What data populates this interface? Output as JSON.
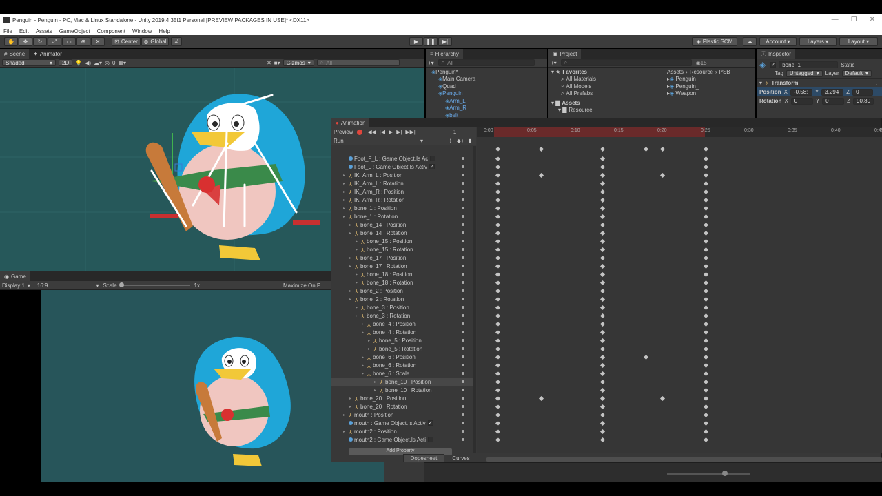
{
  "window": {
    "title": "Penguin - Penguin - PC, Mac & Linux Standalone - Unity 2019.4.35f1 Personal [PREVIEW PACKAGES IN USE]* <DX11>",
    "controls": [
      "—",
      "❐",
      "✕"
    ]
  },
  "menu": [
    "File",
    "Edit",
    "Assets",
    "GameObject",
    "Component",
    "Window",
    "Help"
  ],
  "toolbar": {
    "pivot_label": "Center",
    "space_label": "Global",
    "plastic_label": "Plastic SCM",
    "account_label": "Account",
    "layers_label": "Layers",
    "layout_label": "Layout"
  },
  "scene": {
    "tab_scene": "Scene",
    "tab_animator": "Animator",
    "shading": "Shaded",
    "mode_2d": "2D",
    "hidden_count": "0",
    "gizmos": "Gizmos",
    "search_placeholder": "All"
  },
  "game": {
    "tab": "Game",
    "display": "Display 1",
    "aspect": "16:9",
    "scale_label": "Scale",
    "scale_value": "1x",
    "maximize": "Maximize On P"
  },
  "hierarchy": {
    "tab": "Hierarchy",
    "search_placeholder": "All",
    "items": [
      {
        "label": "Penguin*",
        "indent": 0
      },
      {
        "label": "Main Camera",
        "indent": 1
      },
      {
        "label": "Quad",
        "indent": 1
      },
      {
        "label": "Penguin_",
        "indent": 1
      },
      {
        "label": "Arm_L",
        "indent": 2
      },
      {
        "label": "Arm_R",
        "indent": 2
      },
      {
        "label": "belt",
        "indent": 2
      }
    ]
  },
  "project": {
    "tab": "Project",
    "favorites_label": "Favorites",
    "favorites": [
      "All Materials",
      "All Models",
      "All Prefabs"
    ],
    "assets_label": "Assets",
    "assets_children": [
      "Resource"
    ],
    "breadcrumb": [
      "Assets",
      "Resource",
      "PSB"
    ],
    "files": [
      "Penguin",
      "Penguin_",
      "Weapon"
    ],
    "layer_count": "15"
  },
  "inspector": {
    "tab": "Inspector",
    "object_name": "bone_1",
    "static_label": "Static",
    "tag_label": "Tag",
    "tag_value": "Untagged",
    "layer_label": "Layer",
    "layer_value": "Default",
    "component": "Transform",
    "position_label": "Position",
    "position": {
      "x": "-0.58:",
      "y": "3.294",
      "z": "0"
    },
    "rotation_label": "Rotation",
    "rotation": {
      "x": "0",
      "y": "0",
      "z": "90.80"
    }
  },
  "animation": {
    "tab": "Animation",
    "preview_label": "Preview",
    "frame": "1",
    "clip": "Run",
    "dopesheet_tab": "Dopesheet",
    "curves_tab": "Curves",
    "add_property": "Add Property",
    "timeline_ticks": [
      "0:00",
      "0:05",
      "0:10",
      "0:15",
      "0:20",
      "0:25",
      "0:30",
      "0:35",
      "0:40",
      "0:45"
    ],
    "properties": [
      {
        "label": "Foot_F_L : Game Object.Is Ac",
        "indent": 1,
        "icon": "g",
        "expandable": false,
        "check": ""
      },
      {
        "label": "Foot_L : Game Object.Is Activ",
        "indent": 1,
        "icon": "g",
        "expandable": false,
        "check": "✓"
      },
      {
        "label": "IK_Arm_L : Position",
        "indent": 1,
        "icon": "t",
        "expandable": true,
        "check": null
      },
      {
        "label": "IK_Arm_L : Rotation",
        "indent": 1,
        "icon": "t",
        "expandable": true,
        "check": null
      },
      {
        "label": "IK_Arm_R : Position",
        "indent": 1,
        "icon": "t",
        "expandable": true,
        "check": null
      },
      {
        "label": "IK_Arm_R : Rotation",
        "indent": 1,
        "icon": "t",
        "expandable": true,
        "check": null
      },
      {
        "label": "bone_1 : Position",
        "indent": 1,
        "icon": "t",
        "expandable": true,
        "check": null
      },
      {
        "label": "bone_1 : Rotation",
        "indent": 1,
        "icon": "t",
        "expandable": true,
        "check": null
      },
      {
        "label": "bone_14 : Position",
        "indent": 2,
        "icon": "t",
        "expandable": true,
        "check": null
      },
      {
        "label": "bone_14 : Rotation",
        "indent": 2,
        "icon": "t",
        "expandable": true,
        "check": null
      },
      {
        "label": "bone_15 : Position",
        "indent": 3,
        "icon": "t",
        "expandable": true,
        "check": null
      },
      {
        "label": "bone_15 : Rotation",
        "indent": 3,
        "icon": "t",
        "expandable": true,
        "check": null
      },
      {
        "label": "bone_17 : Position",
        "indent": 2,
        "icon": "t",
        "expandable": true,
        "check": null
      },
      {
        "label": "bone_17 : Rotation",
        "indent": 2,
        "icon": "t",
        "expandable": true,
        "check": null
      },
      {
        "label": "bone_18 : Position",
        "indent": 3,
        "icon": "t",
        "expandable": true,
        "check": null
      },
      {
        "label": "bone_18 : Rotation",
        "indent": 3,
        "icon": "t",
        "expandable": true,
        "check": null
      },
      {
        "label": "bone_2 : Position",
        "indent": 2,
        "icon": "t",
        "expandable": true,
        "check": null
      },
      {
        "label": "bone_2 : Rotation",
        "indent": 2,
        "icon": "t",
        "expandable": true,
        "check": null
      },
      {
        "label": "bone_3 : Position",
        "indent": 3,
        "icon": "t",
        "expandable": true,
        "check": null
      },
      {
        "label": "bone_3 : Rotation",
        "indent": 3,
        "icon": "t",
        "expandable": true,
        "check": null
      },
      {
        "label": "bone_4 : Position",
        "indent": 4,
        "icon": "t",
        "expandable": true,
        "check": null
      },
      {
        "label": "bone_4 : Rotation",
        "indent": 4,
        "icon": "t",
        "expandable": true,
        "check": null
      },
      {
        "label": "bone_5 : Position",
        "indent": 5,
        "icon": "t",
        "expandable": true,
        "check": null
      },
      {
        "label": "bone_5 : Rotation",
        "indent": 5,
        "icon": "t",
        "expandable": true,
        "check": null
      },
      {
        "label": "bone_6 : Position",
        "indent": 4,
        "icon": "t",
        "expandable": true,
        "check": null
      },
      {
        "label": "bone_6 : Rotation",
        "indent": 4,
        "icon": "t",
        "expandable": true,
        "check": null
      },
      {
        "label": "bone_6 : Scale",
        "indent": 4,
        "icon": "t",
        "expandable": true,
        "check": null
      },
      {
        "label": "bone_10 : Position",
        "indent": 6,
        "icon": "t",
        "expandable": true,
        "check": null
      },
      {
        "label": "bone_10 : Rotation",
        "indent": 6,
        "icon": "t",
        "expandable": true,
        "check": null
      },
      {
        "label": "bone_20 : Position",
        "indent": 2,
        "icon": "t",
        "expandable": true,
        "check": null
      },
      {
        "label": "bone_20 : Rotation",
        "indent": 2,
        "icon": "t",
        "expandable": true,
        "check": null
      },
      {
        "label": "mouth : Position",
        "indent": 1,
        "icon": "t",
        "expandable": true,
        "check": null
      },
      {
        "label": "mouth : Game Object.Is Activ",
        "indent": 1,
        "icon": "g",
        "expandable": false,
        "check": "✓"
      },
      {
        "label": "mouth2 : Position",
        "indent": 1,
        "icon": "t",
        "expandable": true,
        "check": null
      },
      {
        "label": "mouth2 : Game Object.Is Acti",
        "indent": 1,
        "icon": "g",
        "expandable": false,
        "check": ""
      }
    ]
  },
  "colors": {
    "record": "#e0463c",
    "selection_blue": "#6aa9e8",
    "timeline_red": "#8a2f2f",
    "scene_bg": "#26585a"
  }
}
